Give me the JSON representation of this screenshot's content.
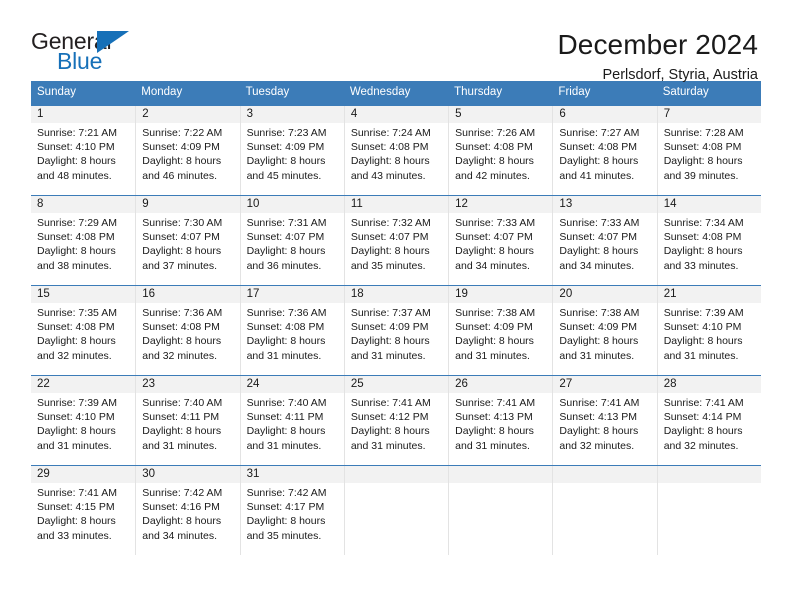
{
  "logo": {
    "word_top": "General",
    "word_bottom": "Blue",
    "flag_icon": "blue-flag-triangle-icon",
    "color_blue": "#1670b8",
    "color_dark": "#231f20"
  },
  "header": {
    "title": "December 2024",
    "subtitle": "Perlsdorf, Styria, Austria"
  },
  "theme": {
    "header_blue": "#3c7cb8",
    "daynum_gray": "#f2f2f2",
    "divider_gray": "#e3e3e3"
  },
  "weekdays": [
    "Sunday",
    "Monday",
    "Tuesday",
    "Wednesday",
    "Thursday",
    "Friday",
    "Saturday"
  ],
  "weeks": [
    [
      {
        "day": "1",
        "sunrise": "Sunrise: 7:21 AM",
        "sunset": "Sunset: 4:10 PM",
        "daylight1": "Daylight: 8 hours",
        "daylight2": "and 48 minutes."
      },
      {
        "day": "2",
        "sunrise": "Sunrise: 7:22 AM",
        "sunset": "Sunset: 4:09 PM",
        "daylight1": "Daylight: 8 hours",
        "daylight2": "and 46 minutes."
      },
      {
        "day": "3",
        "sunrise": "Sunrise: 7:23 AM",
        "sunset": "Sunset: 4:09 PM",
        "daylight1": "Daylight: 8 hours",
        "daylight2": "and 45 minutes."
      },
      {
        "day": "4",
        "sunrise": "Sunrise: 7:24 AM",
        "sunset": "Sunset: 4:08 PM",
        "daylight1": "Daylight: 8 hours",
        "daylight2": "and 43 minutes."
      },
      {
        "day": "5",
        "sunrise": "Sunrise: 7:26 AM",
        "sunset": "Sunset: 4:08 PM",
        "daylight1": "Daylight: 8 hours",
        "daylight2": "and 42 minutes."
      },
      {
        "day": "6",
        "sunrise": "Sunrise: 7:27 AM",
        "sunset": "Sunset: 4:08 PM",
        "daylight1": "Daylight: 8 hours",
        "daylight2": "and 41 minutes."
      },
      {
        "day": "7",
        "sunrise": "Sunrise: 7:28 AM",
        "sunset": "Sunset: 4:08 PM",
        "daylight1": "Daylight: 8 hours",
        "daylight2": "and 39 minutes."
      }
    ],
    [
      {
        "day": "8",
        "sunrise": "Sunrise: 7:29 AM",
        "sunset": "Sunset: 4:08 PM",
        "daylight1": "Daylight: 8 hours",
        "daylight2": "and 38 minutes."
      },
      {
        "day": "9",
        "sunrise": "Sunrise: 7:30 AM",
        "sunset": "Sunset: 4:07 PM",
        "daylight1": "Daylight: 8 hours",
        "daylight2": "and 37 minutes."
      },
      {
        "day": "10",
        "sunrise": "Sunrise: 7:31 AM",
        "sunset": "Sunset: 4:07 PM",
        "daylight1": "Daylight: 8 hours",
        "daylight2": "and 36 minutes."
      },
      {
        "day": "11",
        "sunrise": "Sunrise: 7:32 AM",
        "sunset": "Sunset: 4:07 PM",
        "daylight1": "Daylight: 8 hours",
        "daylight2": "and 35 minutes."
      },
      {
        "day": "12",
        "sunrise": "Sunrise: 7:33 AM",
        "sunset": "Sunset: 4:07 PM",
        "daylight1": "Daylight: 8 hours",
        "daylight2": "and 34 minutes."
      },
      {
        "day": "13",
        "sunrise": "Sunrise: 7:33 AM",
        "sunset": "Sunset: 4:07 PM",
        "daylight1": "Daylight: 8 hours",
        "daylight2": "and 34 minutes."
      },
      {
        "day": "14",
        "sunrise": "Sunrise: 7:34 AM",
        "sunset": "Sunset: 4:08 PM",
        "daylight1": "Daylight: 8 hours",
        "daylight2": "and 33 minutes."
      }
    ],
    [
      {
        "day": "15",
        "sunrise": "Sunrise: 7:35 AM",
        "sunset": "Sunset: 4:08 PM",
        "daylight1": "Daylight: 8 hours",
        "daylight2": "and 32 minutes."
      },
      {
        "day": "16",
        "sunrise": "Sunrise: 7:36 AM",
        "sunset": "Sunset: 4:08 PM",
        "daylight1": "Daylight: 8 hours",
        "daylight2": "and 32 minutes."
      },
      {
        "day": "17",
        "sunrise": "Sunrise: 7:36 AM",
        "sunset": "Sunset: 4:08 PM",
        "daylight1": "Daylight: 8 hours",
        "daylight2": "and 31 minutes."
      },
      {
        "day": "18",
        "sunrise": "Sunrise: 7:37 AM",
        "sunset": "Sunset: 4:09 PM",
        "daylight1": "Daylight: 8 hours",
        "daylight2": "and 31 minutes."
      },
      {
        "day": "19",
        "sunrise": "Sunrise: 7:38 AM",
        "sunset": "Sunset: 4:09 PM",
        "daylight1": "Daylight: 8 hours",
        "daylight2": "and 31 minutes."
      },
      {
        "day": "20",
        "sunrise": "Sunrise: 7:38 AM",
        "sunset": "Sunset: 4:09 PM",
        "daylight1": "Daylight: 8 hours",
        "daylight2": "and 31 minutes."
      },
      {
        "day": "21",
        "sunrise": "Sunrise: 7:39 AM",
        "sunset": "Sunset: 4:10 PM",
        "daylight1": "Daylight: 8 hours",
        "daylight2": "and 31 minutes."
      }
    ],
    [
      {
        "day": "22",
        "sunrise": "Sunrise: 7:39 AM",
        "sunset": "Sunset: 4:10 PM",
        "daylight1": "Daylight: 8 hours",
        "daylight2": "and 31 minutes."
      },
      {
        "day": "23",
        "sunrise": "Sunrise: 7:40 AM",
        "sunset": "Sunset: 4:11 PM",
        "daylight1": "Daylight: 8 hours",
        "daylight2": "and 31 minutes."
      },
      {
        "day": "24",
        "sunrise": "Sunrise: 7:40 AM",
        "sunset": "Sunset: 4:11 PM",
        "daylight1": "Daylight: 8 hours",
        "daylight2": "and 31 minutes."
      },
      {
        "day": "25",
        "sunrise": "Sunrise: 7:41 AM",
        "sunset": "Sunset: 4:12 PM",
        "daylight1": "Daylight: 8 hours",
        "daylight2": "and 31 minutes."
      },
      {
        "day": "26",
        "sunrise": "Sunrise: 7:41 AM",
        "sunset": "Sunset: 4:13 PM",
        "daylight1": "Daylight: 8 hours",
        "daylight2": "and 31 minutes."
      },
      {
        "day": "27",
        "sunrise": "Sunrise: 7:41 AM",
        "sunset": "Sunset: 4:13 PM",
        "daylight1": "Daylight: 8 hours",
        "daylight2": "and 32 minutes."
      },
      {
        "day": "28",
        "sunrise": "Sunrise: 7:41 AM",
        "sunset": "Sunset: 4:14 PM",
        "daylight1": "Daylight: 8 hours",
        "daylight2": "and 32 minutes."
      }
    ],
    [
      {
        "day": "29",
        "sunrise": "Sunrise: 7:41 AM",
        "sunset": "Sunset: 4:15 PM",
        "daylight1": "Daylight: 8 hours",
        "daylight2": "and 33 minutes."
      },
      {
        "day": "30",
        "sunrise": "Sunrise: 7:42 AM",
        "sunset": "Sunset: 4:16 PM",
        "daylight1": "Daylight: 8 hours",
        "daylight2": "and 34 minutes."
      },
      {
        "day": "31",
        "sunrise": "Sunrise: 7:42 AM",
        "sunset": "Sunset: 4:17 PM",
        "daylight1": "Daylight: 8 hours",
        "daylight2": "and 35 minutes."
      },
      {
        "day": "",
        "sunrise": "",
        "sunset": "",
        "daylight1": "",
        "daylight2": ""
      },
      {
        "day": "",
        "sunrise": "",
        "sunset": "",
        "daylight1": "",
        "daylight2": ""
      },
      {
        "day": "",
        "sunrise": "",
        "sunset": "",
        "daylight1": "",
        "daylight2": ""
      },
      {
        "day": "",
        "sunrise": "",
        "sunset": "",
        "daylight1": "",
        "daylight2": ""
      }
    ]
  ]
}
